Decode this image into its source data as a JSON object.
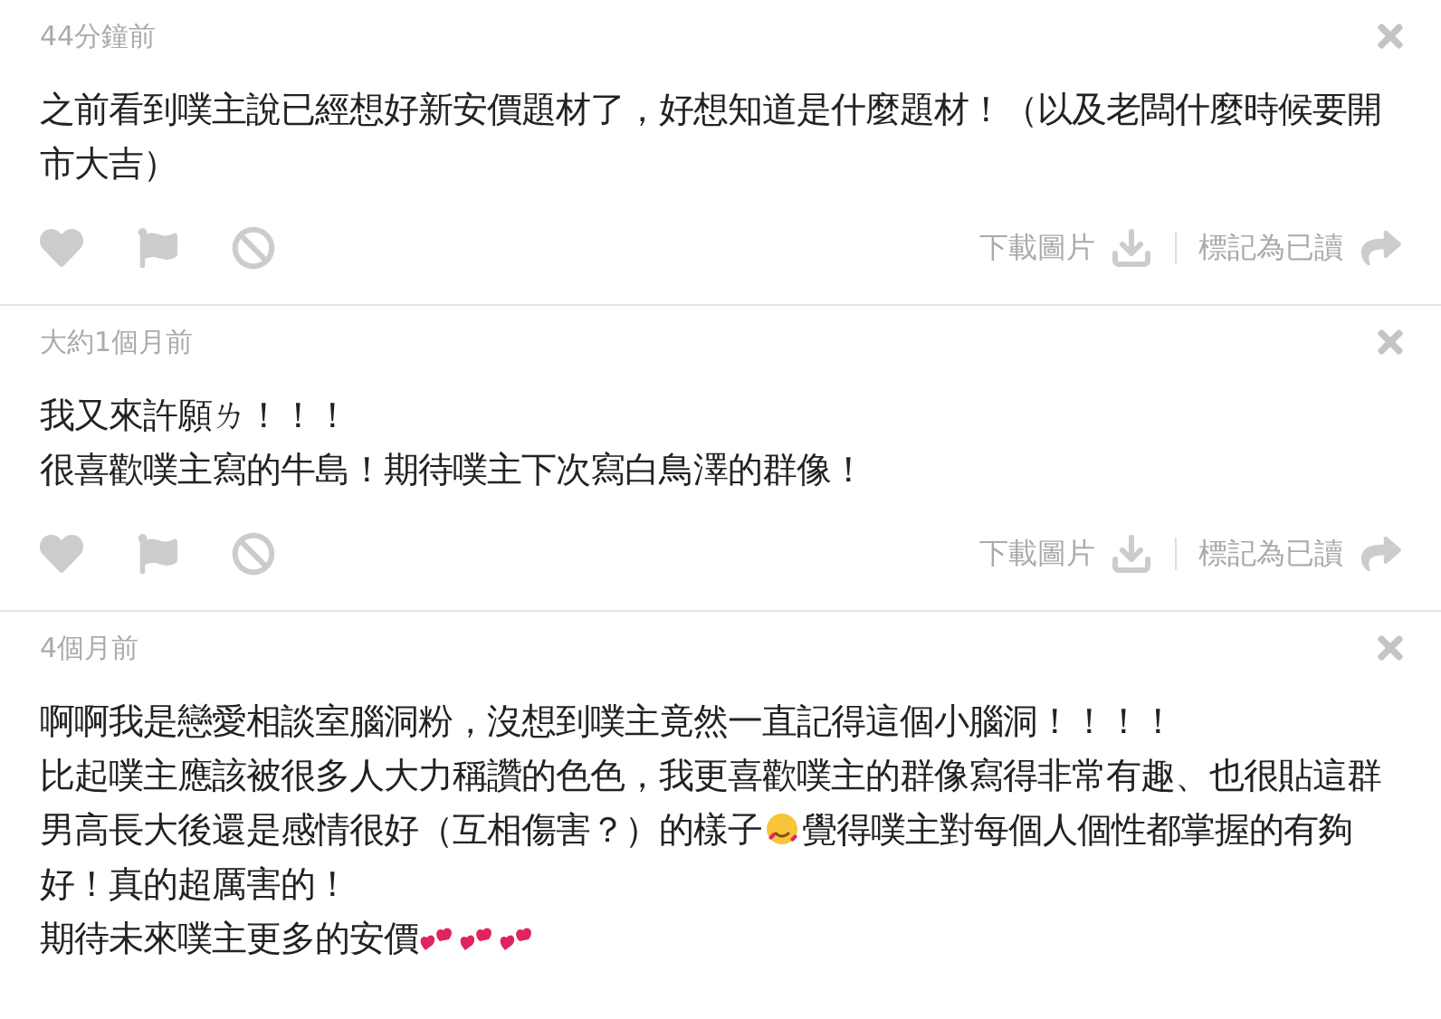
{
  "comments": [
    {
      "time": "44分鐘前",
      "paragraphs": [
        [
          {
            "kind": "text",
            "text": "之前看到噗主說已經想好新安價題材了，好想知道是什麼題材！（以及老闆什麼時候要開市大吉）"
          }
        ]
      ],
      "actions": {
        "download": "下載圖片",
        "mark_read": "標記為已讀"
      }
    },
    {
      "time": "大約1個月前",
      "paragraphs": [
        [
          {
            "kind": "text",
            "text": "我又來許願ㄌ！！！"
          }
        ],
        [
          {
            "kind": "text",
            "text": "很喜歡噗主寫的牛島！期待噗主下次寫白鳥澤的群像！"
          }
        ]
      ],
      "actions": {
        "download": "下載圖片",
        "mark_read": "標記為已讀"
      }
    },
    {
      "time": "4個月前",
      "paragraphs": [
        [
          {
            "kind": "text",
            "text": "啊啊我是戀愛相談室腦洞粉，沒想到噗主竟然一直記得這個小腦洞！！！！"
          }
        ],
        [
          {
            "kind": "text",
            "text": "比起噗主應該被很多人大力稱讚的色色，我更喜歡噗主的群像寫得非常有趣、也很貼這群男高長大後還是感情很好（互相傷害？）的樣子"
          },
          {
            "kind": "smiley"
          },
          {
            "kind": "text",
            "text": "覺得噗主對每個人個性都掌握的有夠好！真的超厲害的！"
          }
        ],
        [
          {
            "kind": "text",
            "text": "期待未來噗主更多的安價"
          },
          {
            "kind": "hearts"
          },
          {
            "kind": "hearts"
          },
          {
            "kind": "hearts"
          }
        ]
      ]
    }
  ]
}
